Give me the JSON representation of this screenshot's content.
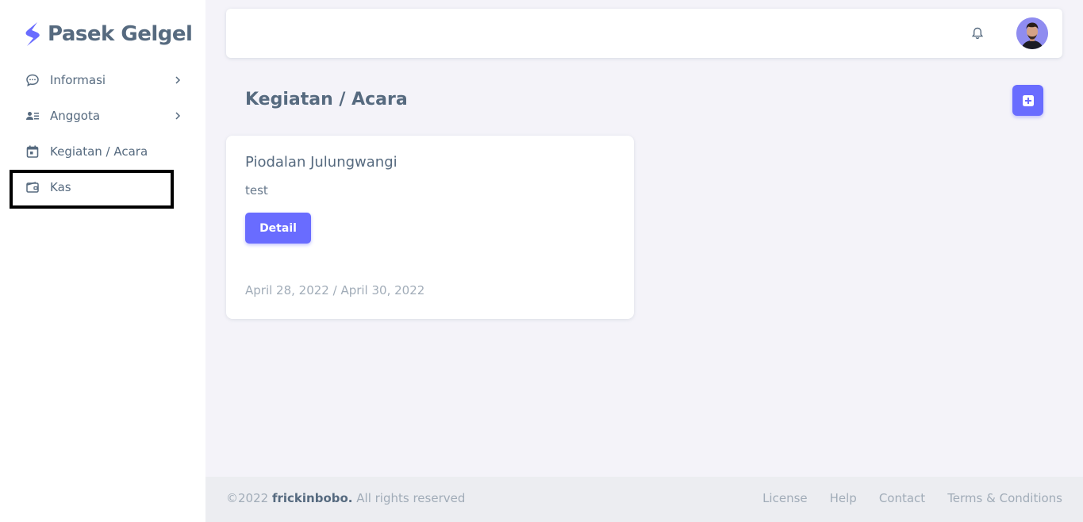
{
  "brand": {
    "name": "Pasek Gelgel"
  },
  "sidebar": {
    "items": [
      {
        "label": "Informasi",
        "icon": "chat-bubble-icon",
        "has_submenu": true
      },
      {
        "label": "Anggota",
        "icon": "user-list-icon",
        "has_submenu": true
      },
      {
        "label": "Kegiatan / Acara",
        "icon": "calendar-icon",
        "has_submenu": false
      },
      {
        "label": "Kas",
        "icon": "wallet-icon",
        "has_submenu": false
      }
    ]
  },
  "page": {
    "title": "Kegiatan / Acara"
  },
  "events": [
    {
      "title": "Piodalan Julungwangi",
      "description": "test",
      "button_label": "Detail",
      "date_range": "April 28, 2022 / April 30, 2022"
    }
  ],
  "footer": {
    "copyright_prefix": "©2022 ",
    "author": "frickinbobo.",
    "copyright_suffix": " All rights reserved",
    "links": [
      "License",
      "Help",
      "Contact",
      "Terms & Conditions"
    ]
  },
  "colors": {
    "primary": "#696cff",
    "text": "#566a7f",
    "muted": "#a1acb8",
    "background": "#f4f3f9"
  }
}
